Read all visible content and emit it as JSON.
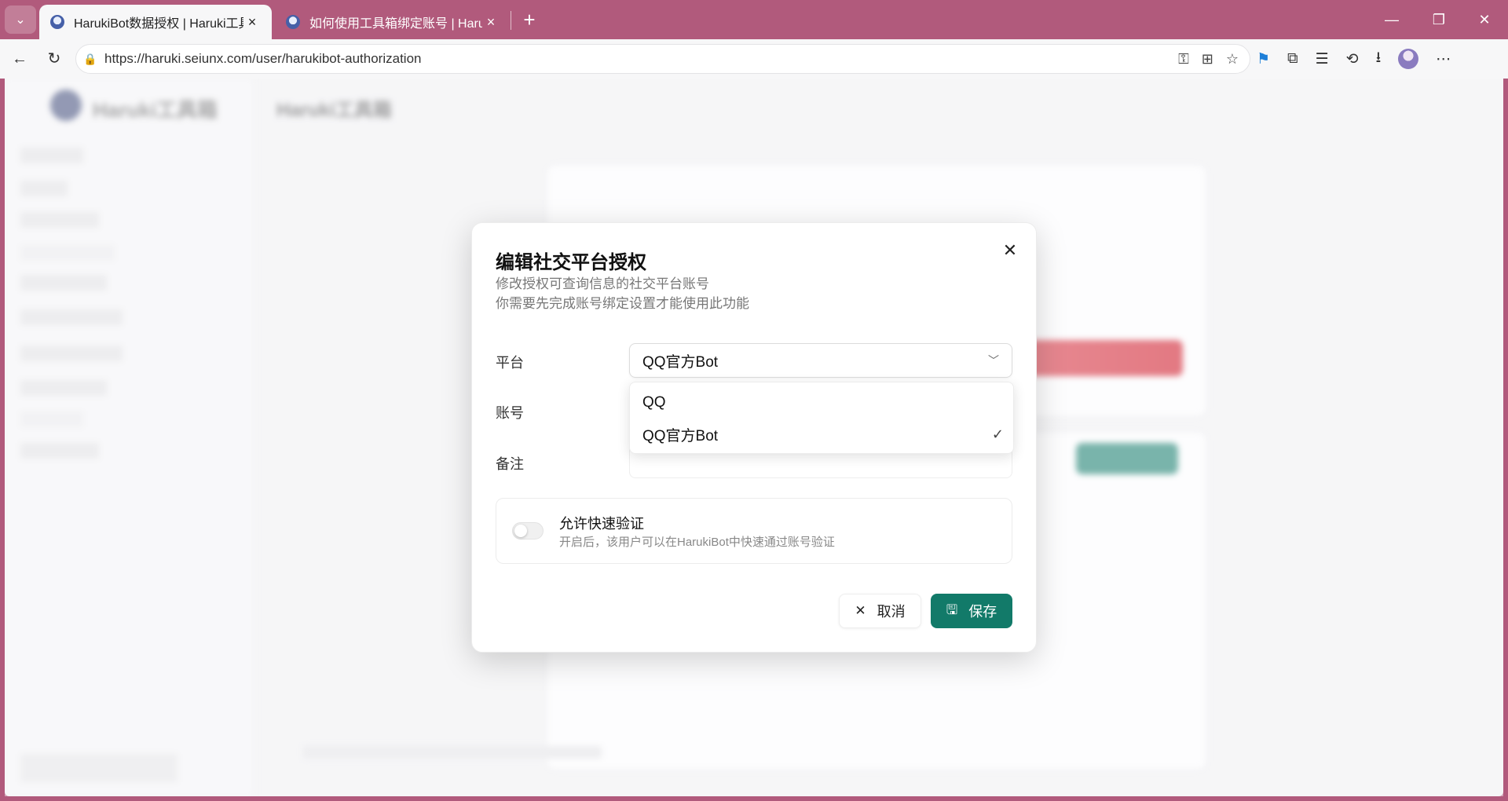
{
  "browser": {
    "tabs": [
      {
        "title": "HarukiBot数据授权 | Haruki工具箱",
        "active": true
      },
      {
        "title": "如何使用工具箱绑定账号 | HarukiBot",
        "active": false
      }
    ],
    "url": "https://haruki.seiunx.com/user/harukibot-authorization",
    "window_controls": {
      "minimize": "—",
      "restore": "❐",
      "close": "✕"
    }
  },
  "background": {
    "app_name": "Haruki工具箱",
    "topbar_title": "Haruki工具箱"
  },
  "modal": {
    "title": "编辑社交平台授权",
    "description_line1": "修改授权可查询信息的社交平台账号",
    "description_line2": "你需要先完成账号绑定设置才能使用此功能",
    "platform_label": "平台",
    "platform_value": "QQ官方Bot",
    "account_label": "账号",
    "note_label": "备注",
    "quick_verify_title": "允许快速验证",
    "quick_verify_desc": "开启后，该用户可以在HarukiBot中快速通过账号验证",
    "quick_verify_on": false,
    "cancel_label": "取消",
    "save_label": "保存"
  },
  "dropdown": {
    "options": [
      {
        "label": "QQ",
        "selected": false
      },
      {
        "label": "QQ官方Bot",
        "selected": true
      }
    ]
  },
  "colors": {
    "tabbar": "#b15a7c",
    "primary_button": "#127a69"
  }
}
